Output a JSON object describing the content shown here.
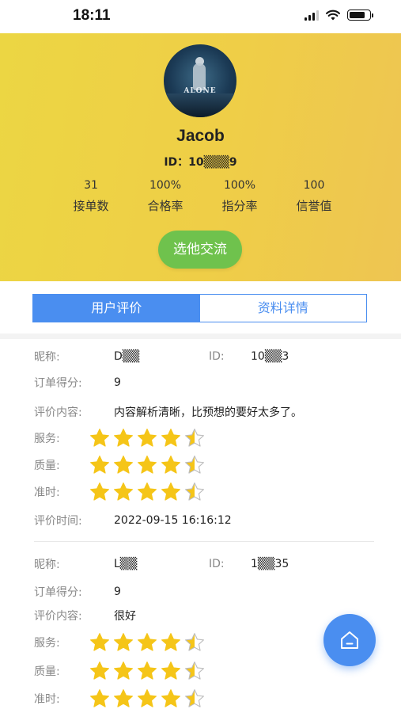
{
  "status_bar": {
    "time": "18:11"
  },
  "profile": {
    "avatar_text": "ALONE",
    "name": "Jacob",
    "id_label": "ID：10▒▒▒9",
    "stats": [
      {
        "value": "31",
        "label": "接单数"
      },
      {
        "value": "100%",
        "label": "合格率"
      },
      {
        "value": "100%",
        "label": "指分率"
      },
      {
        "value": "100",
        "label": "信誉值"
      }
    ],
    "chat_button": "选他交流"
  },
  "tabs": [
    {
      "label": "用户评价",
      "active": true
    },
    {
      "label": "资料详情",
      "active": false
    }
  ],
  "reviews": [
    {
      "nickname_label": "昵称:",
      "nickname": "D▒▒",
      "id_label": "ID:",
      "id_value": "10▒▒3",
      "score_label": "订单得分:",
      "score": "9",
      "content_label": "评价内容:",
      "content": "内容解析清晰，比预想的要好太多了。",
      "service_label": "服务:",
      "service_rating": 4.5,
      "quality_label": "质量:",
      "quality_rating": 4.5,
      "ontime_label": "准时:",
      "ontime_rating": 4.5,
      "time_label": "评价时间:",
      "time": "2022-09-15 16:16:12"
    },
    {
      "nickname_label": "昵称:",
      "nickname": "L▒▒",
      "id_label": "ID:",
      "id_value": "1▒▒35",
      "score_label": "订单得分:",
      "score": "9",
      "content_label": "评价内容:",
      "content": "很好",
      "service_label": "服务:",
      "service_rating": 4.5,
      "quality_label": "质量:",
      "quality_rating": 4.5,
      "ontime_label": "准时:",
      "ontime_rating": 4.5
    }
  ],
  "colors": {
    "accent": "#4a8ef0",
    "chat_button": "#6fc24d",
    "header_yellow": "#efce47",
    "star": "#f5c518"
  },
  "icons": {
    "home_button": "home-icon",
    "rating": "star-icon"
  }
}
